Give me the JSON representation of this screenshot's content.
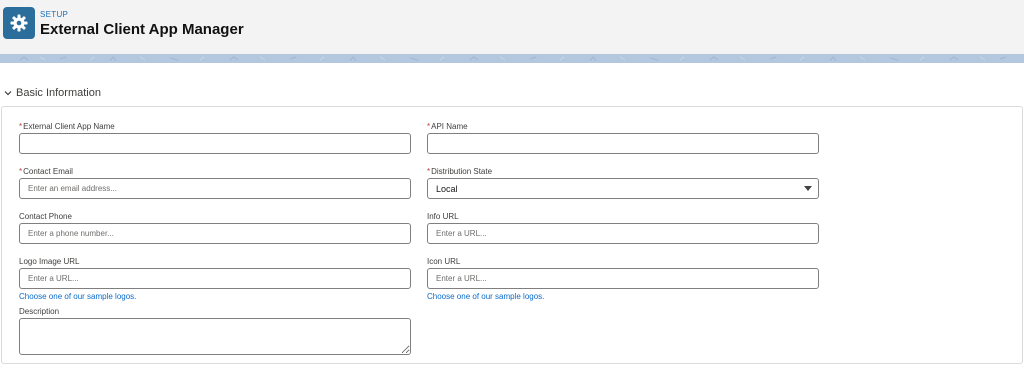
{
  "header": {
    "eyebrow": "SETUP",
    "title": "External Client App Manager",
    "icon": "gear-icon",
    "icon_bg": "#2b6d9b"
  },
  "section": {
    "title": "Basic Information",
    "icon": "chevron-down-icon"
  },
  "form": {
    "app_name": {
      "label": "External Client App Name",
      "required": "*",
      "value": "",
      "placeholder": ""
    },
    "api_name": {
      "label": "API Name",
      "required": "*",
      "value": "",
      "placeholder": ""
    },
    "contact_email": {
      "label": "Contact Email",
      "required": "*",
      "value": "",
      "placeholder": "Enter an email address..."
    },
    "distribution_state": {
      "label": "Distribution State",
      "required": "*",
      "value": "Local"
    },
    "contact_phone": {
      "label": "Contact Phone",
      "value": "",
      "placeholder": "Enter a phone number..."
    },
    "info_url": {
      "label": "Info URL",
      "value": "",
      "placeholder": "Enter a URL..."
    },
    "logo_image_url": {
      "label": "Logo Image URL",
      "value": "",
      "placeholder": "Enter a URL...",
      "link": "Choose one of our sample logos."
    },
    "icon_url": {
      "label": "Icon URL",
      "value": "",
      "placeholder": "Enter a URL...",
      "link": "Choose one of our sample logos."
    },
    "description": {
      "label": "Description",
      "value": ""
    }
  },
  "colors": {
    "link": "#0b6bcb",
    "required": "#c23934",
    "band": "#b2c6de"
  }
}
